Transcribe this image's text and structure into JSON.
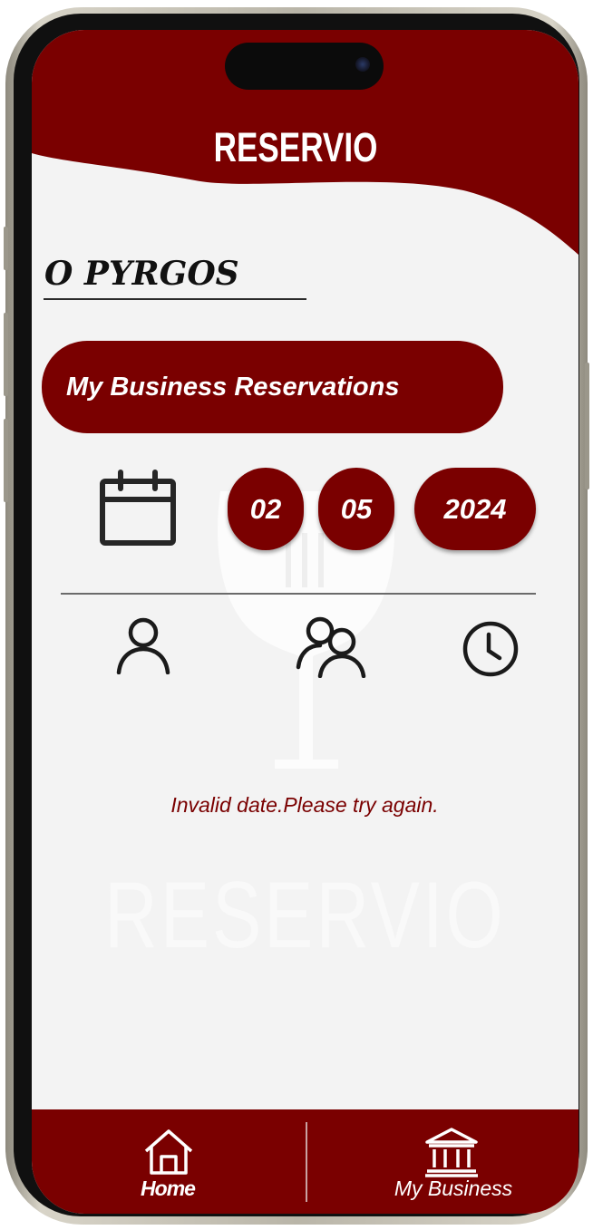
{
  "app": {
    "title": "RESERVIO",
    "watermark_text": "RESERVIO"
  },
  "business": {
    "name": "O PYRGOS"
  },
  "reservations_button": {
    "label": "My Business Reservations"
  },
  "date": {
    "day": "02",
    "month": "05",
    "year": "2024"
  },
  "filter_icons": [
    "person-icon",
    "group-icon",
    "clock-icon"
  ],
  "error": {
    "message": "Invalid date.Please try again."
  },
  "bottom_nav": {
    "items": [
      {
        "label": "Home",
        "icon": "home-icon",
        "active": true
      },
      {
        "label": "My Business",
        "icon": "bank-icon",
        "active": false
      }
    ]
  },
  "colors": {
    "brand": "#7a0000",
    "background": "#f3f3f3",
    "text_dark": "#111111",
    "white": "#ffffff"
  }
}
